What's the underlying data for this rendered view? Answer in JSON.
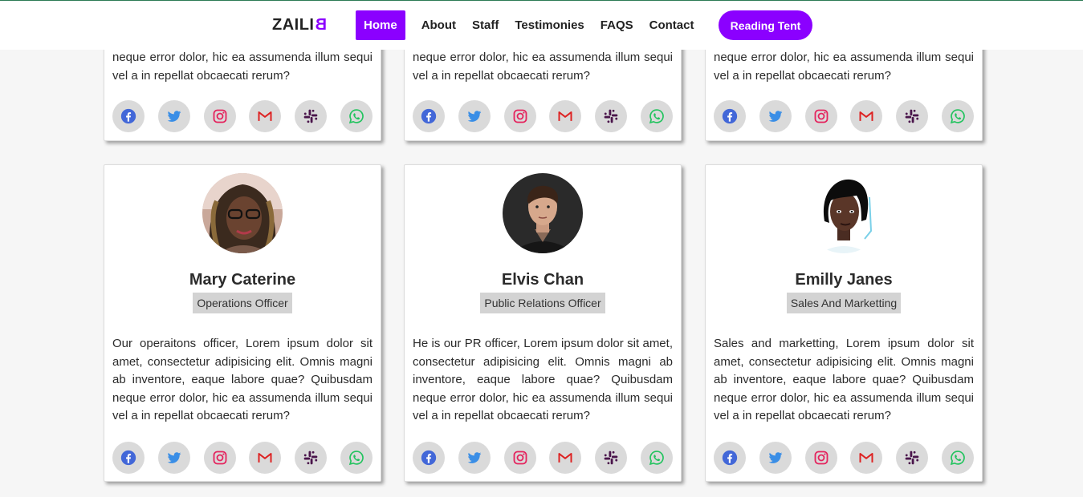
{
  "brand": {
    "logo_text": "ZAILI",
    "logo_flipped": "B"
  },
  "nav": {
    "items": [
      {
        "label": "Home",
        "active": true
      },
      {
        "label": "About"
      },
      {
        "label": "Staff"
      },
      {
        "label": "Testimonies"
      },
      {
        "label": "FAQS"
      },
      {
        "label": "Contact"
      }
    ],
    "cta_label": "Reading Tent"
  },
  "colors": {
    "accent": "#8b00ff",
    "social_bg": "#dadada"
  },
  "top_cards": [
    {
      "desc": "neque error dolor, hic ea assumenda illum sequi vel a in repellat obcaecati rerum?"
    },
    {
      "desc": "neque error dolor, hic ea assumenda illum sequi vel a in repellat obcaecati rerum?"
    },
    {
      "desc": "neque error dolor, hic ea assumenda illum sequi vel a in repellat obcaecati rerum?"
    }
  ],
  "staff": [
    {
      "name": "Mary Caterine",
      "role": "Operations Officer",
      "desc": "Our operaitons officer, Lorem ipsum dolor sit amet, consectetur adipisicing elit. Omnis magni ab inventore, eaque labore quae? Quibusdam neque error dolor, hic ea assumenda illum sequi vel a in repellat obcaecati rerum?",
      "avatar": "woman-with-glasses-photo"
    },
    {
      "name": "Elvis Chan",
      "role": "Public Relations Officer",
      "desc": "He is our PR officer, Lorem ipsum dolor sit amet, consectetur adipisicing elit. Omnis magni ab inventore, eaque labore quae? Quibusdam neque error dolor, hic ea assumenda illum sequi vel a in repellat obcaecati rerum?",
      "avatar": "man-in-dark-shirt-photo"
    },
    {
      "name": "Emilly Janes",
      "role": "Sales And Marketting",
      "desc": "Sales and marketting, Lorem ipsum dolor sit amet, consectetur adipisicing elit. Omnis magni ab inventore, eaque labore quae? Quibusdam neque error dolor, hic ea assumenda illum sequi vel a in repellat obcaecati rerum?",
      "avatar": "woman-with-bob-haircut-photo"
    }
  ],
  "social_icons": [
    "facebook-icon",
    "twitter-icon",
    "instagram-icon",
    "gmail-icon",
    "slack-icon",
    "whatsapp-icon"
  ]
}
